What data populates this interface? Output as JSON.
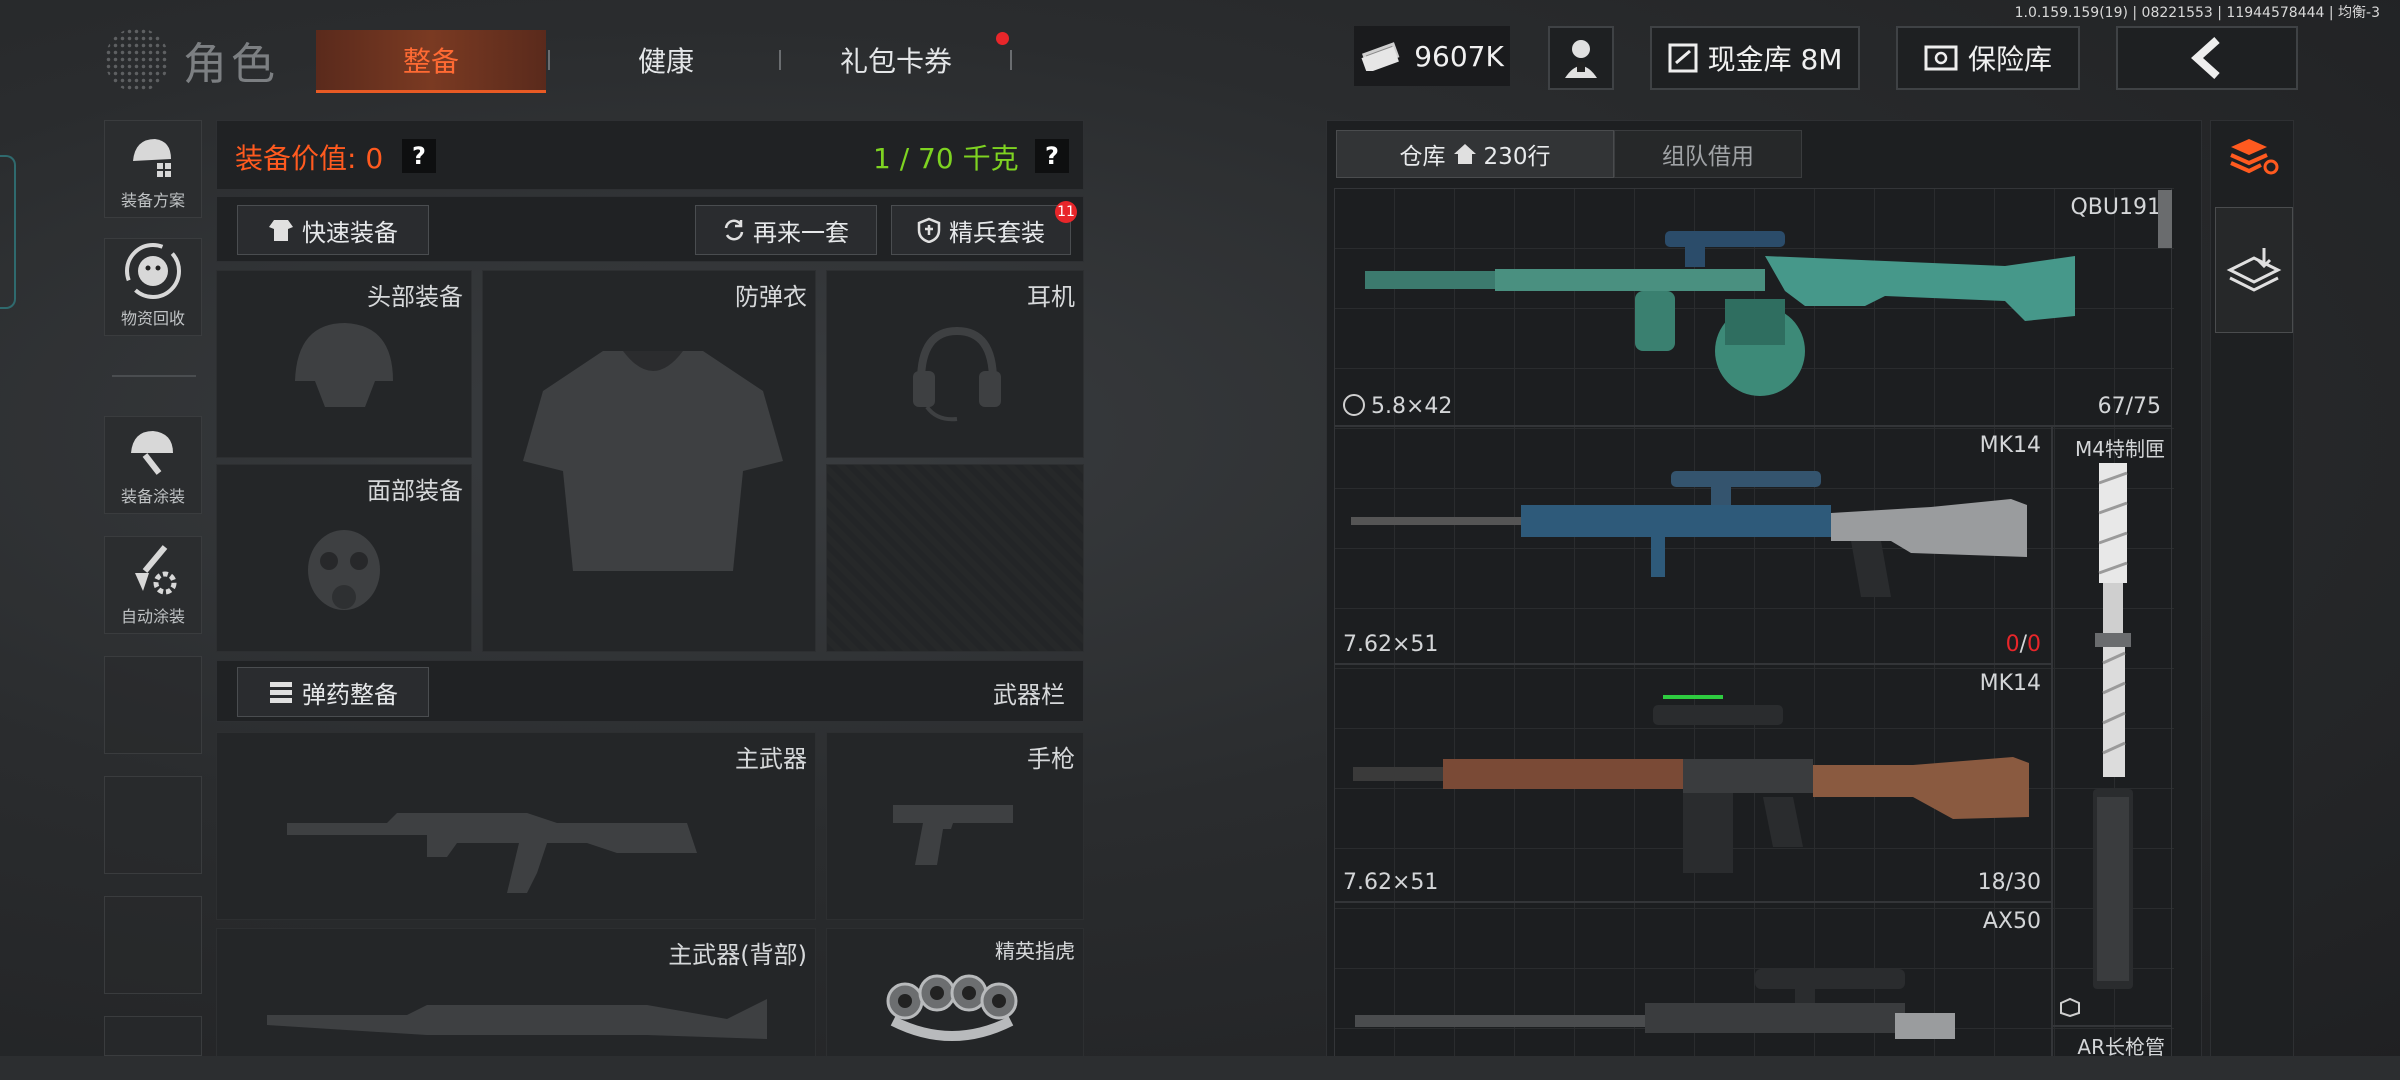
{
  "version": "1.0.159.159(19) | 08221553 | 11944578444 | 均衡-3",
  "header": {
    "title": "角色",
    "tabs": [
      {
        "label": "整备",
        "active": true
      },
      {
        "label": "健康",
        "active": false
      },
      {
        "label": "礼包卡券",
        "active": false,
        "has_notification": true
      }
    ],
    "currency": "9607K",
    "cash_vault": "现金库 8M",
    "safe": "保险库",
    "back_icon": "chevron-left-icon"
  },
  "sidebar": {
    "items": [
      {
        "label": "装备方案",
        "icon": "helmet-grid-icon"
      },
      {
        "label": "物资回收",
        "icon": "recycle-face-icon"
      },
      {
        "label": "装备涂装",
        "icon": "helmet-paint-icon"
      },
      {
        "label": "自动涂装",
        "icon": "brush-gear-icon"
      }
    ]
  },
  "loadout": {
    "value_label": "装备价值: 0",
    "weight_label": "1 / 70 千克",
    "quick_equip": "快速装备",
    "again": "再来一套",
    "elite_set": "精兵套装",
    "elite_badge": "11",
    "slots": {
      "head": "头部装备",
      "armor": "防弹衣",
      "headset": "耳机",
      "face": "面部装备",
      "ammo": "弹药整备",
      "weapon_bar": "武器栏",
      "primary": "主武器",
      "pistol": "手枪",
      "primary_back": "主武器(背部)",
      "melee": "精英指虎"
    }
  },
  "warehouse": {
    "tab_storage": "仓库",
    "tab_storage_rows": "230行",
    "tab_team": "组队借用",
    "items": [
      {
        "name": "QBU191",
        "caliber": "5.8×42",
        "ammo": "67/75"
      },
      {
        "name": "MK14",
        "caliber": "7.62×51",
        "ammo_cur": "0",
        "ammo_max": "0"
      },
      {
        "name": "MK14",
        "caliber": "7.62×51",
        "ammo": "18/30"
      },
      {
        "name": "AX50",
        "caliber": "",
        "ammo": ""
      },
      {
        "name": "M4特制匣",
        "caliber": "",
        "ammo": ""
      },
      {
        "name": "AR长枪管",
        "caliber": "",
        "ammo": ""
      }
    ]
  },
  "colors": {
    "accent": "#ff5a1f",
    "green": "#7ed321",
    "red": "#e8262a"
  }
}
